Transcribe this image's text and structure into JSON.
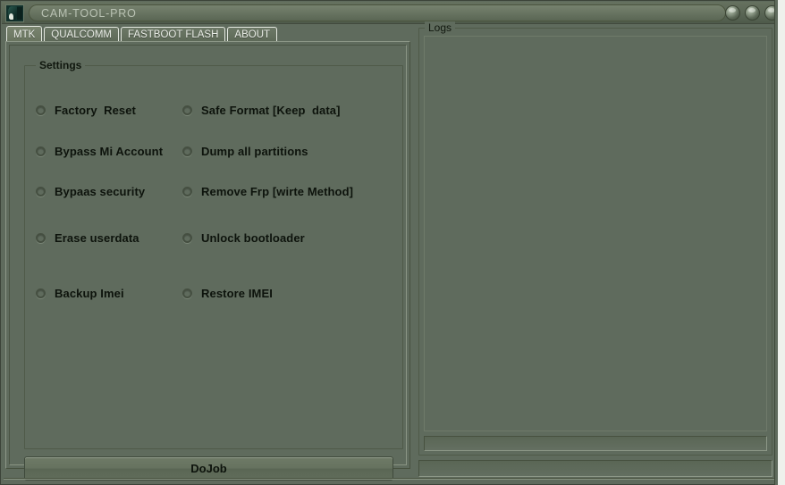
{
  "window": {
    "title": "CAM-TOOL-PRO",
    "icon_name": "app-icon",
    "buttons": [
      {
        "name": "minimize-button",
        "label": ""
      },
      {
        "name": "maximize-button",
        "label": ""
      },
      {
        "name": "close-button",
        "label": ""
      }
    ]
  },
  "tabs": [
    {
      "label": "MTK",
      "active": true
    },
    {
      "label": "QUALCOMM",
      "active": false
    },
    {
      "label": "FASTBOOT FLASH",
      "active": false
    },
    {
      "label": "ABOUT",
      "active": false
    }
  ],
  "settings": {
    "title": "Settings",
    "options_left": [
      {
        "label": "Factory  Reset",
        "selected": false
      },
      {
        "label": "Bypass Mi Account",
        "selected": false
      },
      {
        "label": "Bypaas security",
        "selected": false
      },
      {
        "label": "Erase userdata",
        "selected": false
      },
      {
        "label": "Backup Imei",
        "selected": false
      }
    ],
    "options_right": [
      {
        "label": "Safe Format [Keep  data]",
        "selected": false
      },
      {
        "label": "Dump all partitions",
        "selected": false
      },
      {
        "label": "Remove Frp [wirte Method]",
        "selected": false
      },
      {
        "label": "Unlock bootloader",
        "selected": false
      },
      {
        "label": "Restore IMEI",
        "selected": false
      }
    ]
  },
  "actions": {
    "dojob_label": "DoJob"
  },
  "logs": {
    "title": "Logs",
    "content": ""
  },
  "status": {
    "text": ""
  },
  "colors": {
    "window_background": "#5f6b5d",
    "panel_border_light": "#8d9888",
    "panel_border_dark": "#47513f",
    "text_primary": "#0d130c",
    "title_text": "#b9c2b3",
    "tab_border": "#e4e8e0"
  }
}
